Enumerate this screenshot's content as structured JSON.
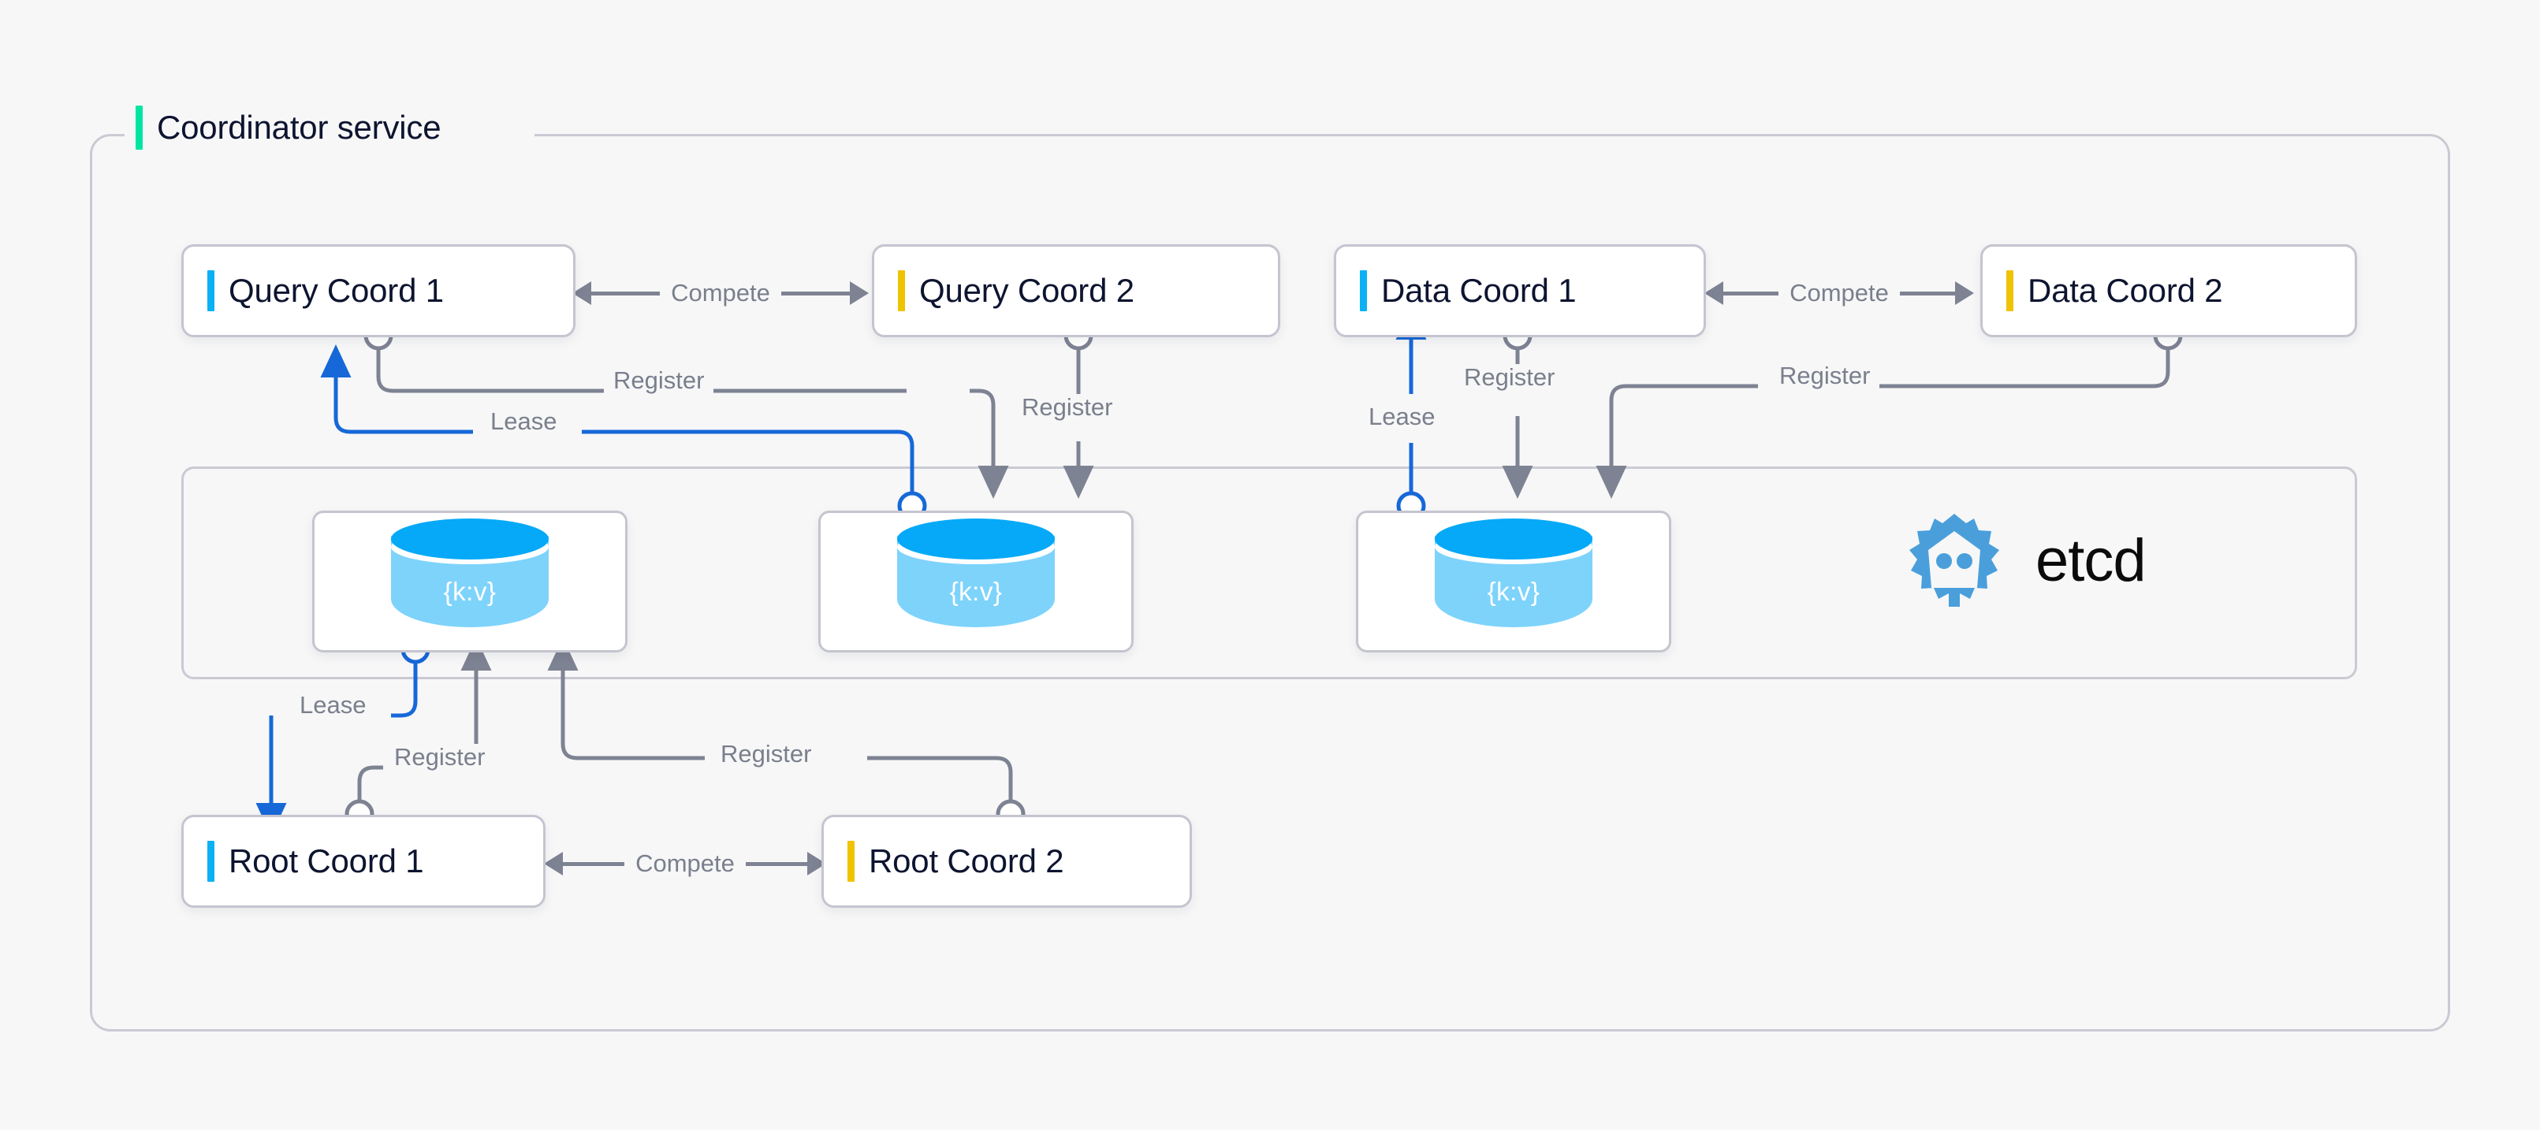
{
  "group": {
    "title": "Coordinator service",
    "accent_color": "#00e6a2"
  },
  "colors": {
    "primary_accent": "#0cb0f5",
    "secondary_accent": "#efc300",
    "lease_line": "#1668d8",
    "register_line": "#7e8393",
    "border": "#c4c5cf",
    "text": "#0d1430",
    "muted_text": "#7a7f8c",
    "cylinder_top": "#06a9f7",
    "cylinder_body": "#7ed3fb",
    "etcd_logo": "#4a9fdb"
  },
  "nodes": [
    {
      "id": "query-coord-1",
      "label": "Query Coord 1",
      "accent": "primary"
    },
    {
      "id": "query-coord-2",
      "label": "Query Coord 2",
      "accent": "secondary"
    },
    {
      "id": "data-coord-1",
      "label": "Data Coord 1",
      "accent": "primary"
    },
    {
      "id": "data-coord-2",
      "label": "Data Coord 2",
      "accent": "secondary"
    },
    {
      "id": "root-coord-1",
      "label": "Root Coord 1",
      "accent": "primary"
    },
    {
      "id": "root-coord-2",
      "label": "Root Coord 2",
      "accent": "secondary"
    }
  ],
  "etcd": {
    "logo_text": "etcd",
    "logo_icon": "etcd-gear-robot-icon",
    "stores": [
      {
        "id": "kv-store-1",
        "text": "{k:v}"
      },
      {
        "id": "kv-store-2",
        "text": "{k:v}"
      },
      {
        "id": "kv-store-3",
        "text": "{k:v}"
      }
    ]
  },
  "edges": {
    "compete": [
      {
        "id": "compete-query",
        "label": "Compete",
        "from": "query-coord-1",
        "to": "query-coord-2"
      },
      {
        "id": "compete-data",
        "label": "Compete",
        "from": "data-coord-1",
        "to": "data-coord-2"
      },
      {
        "id": "compete-root",
        "label": "Compete",
        "from": "root-coord-1",
        "to": "root-coord-2"
      }
    ],
    "lease": [
      {
        "id": "lease-query",
        "label": "Lease",
        "from": "kv-store-2",
        "to": "query-coord-1"
      },
      {
        "id": "lease-data",
        "label": "Lease",
        "from": "kv-store-3",
        "to": "data-coord-1"
      },
      {
        "id": "lease-root",
        "label": "Lease",
        "from": "kv-store-1",
        "to": "root-coord-1"
      }
    ],
    "register": [
      {
        "id": "register-qc1",
        "label": "Register",
        "from": "query-coord-1",
        "to": "kv-store-2"
      },
      {
        "id": "register-qc2",
        "label": "Register",
        "from": "query-coord-2",
        "to": "kv-store-2"
      },
      {
        "id": "register-dc1",
        "label": "Register",
        "from": "data-coord-1",
        "to": "kv-store-3"
      },
      {
        "id": "register-dc2",
        "label": "Register",
        "from": "data-coord-2",
        "to": "kv-store-3"
      },
      {
        "id": "register-rc1",
        "label": "Register",
        "from": "root-coord-1",
        "to": "kv-store-1"
      },
      {
        "id": "register-rc2",
        "label": "Register",
        "from": "root-coord-2",
        "to": "kv-store-1"
      }
    ]
  }
}
